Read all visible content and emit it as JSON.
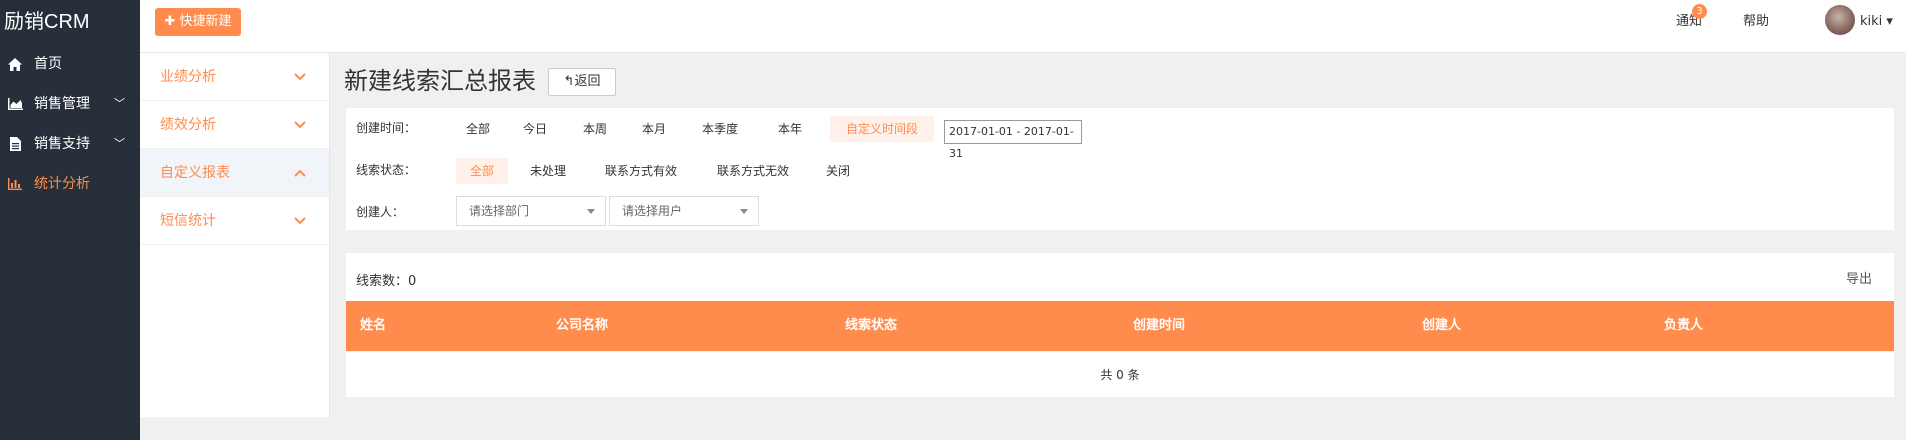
{
  "app": {
    "brand": "励销CRM"
  },
  "sidebar": {
    "items": [
      {
        "label": "首页",
        "icon": "home-icon",
        "chevron": ""
      },
      {
        "label": "销售管理",
        "icon": "area-chart-icon",
        "chevron": "﹀"
      },
      {
        "label": "销售支持",
        "icon": "document-icon",
        "chevron": "﹀"
      },
      {
        "label": "统计分析",
        "icon": "bar-chart-icon",
        "chevron": ""
      }
    ]
  },
  "topbar": {
    "quick_new": "✚ 快捷新建",
    "notify": "通知",
    "notify_count": "3",
    "help": "帮助",
    "user": "kiki",
    "user_caret": "▾"
  },
  "submenu": {
    "items": [
      {
        "label": "业绩分析"
      },
      {
        "label": "绩效分析"
      },
      {
        "label": "自定义报表"
      },
      {
        "label": "短信统计"
      }
    ]
  },
  "page": {
    "title": "新建线索汇总报表",
    "back": "↰返回"
  },
  "filters": {
    "created_time_label": "创建时间：",
    "time_options": [
      "全部",
      "今日",
      "本周",
      "本月",
      "本季度",
      "本年",
      "自定义时间段"
    ],
    "date_range": "2017-01-01 - 2017-01-31",
    "status_label": "线索状态：",
    "status_options": [
      "全部",
      "未处理",
      "联系方式有效",
      "联系方式无效",
      "关闭"
    ],
    "creator_label": "创建人：",
    "dept_placeholder": "请选择部门",
    "user_placeholder": "请选择用户"
  },
  "table": {
    "count_label": "线索数：0",
    "export": "导出",
    "columns": [
      "姓名",
      "公司名称",
      "线索状态",
      "创建时间",
      "创建人",
      "负责人"
    ],
    "empty": "共 0 条"
  },
  "colors": {
    "accent": "#ff8c4d",
    "sidebar_bg": "#27303a"
  }
}
